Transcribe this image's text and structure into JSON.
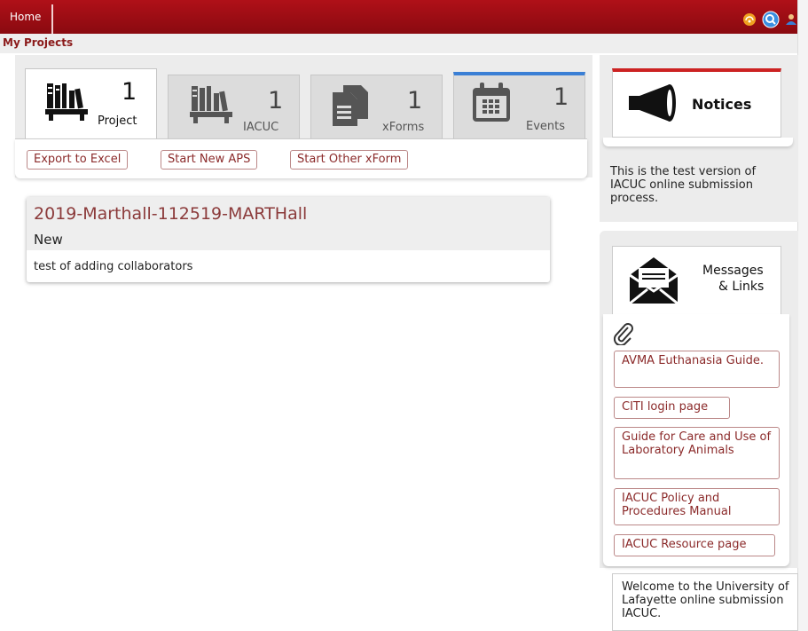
{
  "topbar": {
    "home_label": "Home",
    "icons": [
      "signal-icon",
      "search-icon",
      "user-icon"
    ]
  },
  "subbar": {
    "title": "My Projects"
  },
  "tabs": [
    {
      "count": "1",
      "label": "Project",
      "icon": "bookshelf-icon",
      "active": true
    },
    {
      "count": "1",
      "label": "IACUC",
      "icon": "bookshelf-icon",
      "active": false
    },
    {
      "count": "1",
      "label": "xForms",
      "icon": "documents-icon",
      "active": false
    },
    {
      "count": "1",
      "label": "Events",
      "icon": "calendar-icon",
      "active": false
    }
  ],
  "toolbar": {
    "export_label": "Export to Excel",
    "new_aps_label": "Start New APS",
    "other_xform_label": "Start Other xForm"
  },
  "project": {
    "name": "2019-Marthall-112519-MARTHall",
    "status": "New",
    "description": "test of adding collaborators"
  },
  "notices": {
    "title": "Notices",
    "text": "This is the test version of IACUC online submission process."
  },
  "messages": {
    "title_line1": "Messages",
    "title_line2": "& Links",
    "links": [
      "AVMA Euthanasia Guide.",
      "CITI login page",
      "Guide for Care and Use of Laboratory Animals",
      "IACUC Policy and Procedures Manual",
      "IACUC Resource page"
    ]
  },
  "welcome": {
    "line1": "Welcome to the University of",
    "line2": "Lafayette online submission",
    "line3": "IACUC."
  },
  "colors": {
    "brand": "#a00e16",
    "link": "#8b2a2a",
    "events_accent": "#3a7fd5",
    "notices_accent": "#cc2222"
  }
}
